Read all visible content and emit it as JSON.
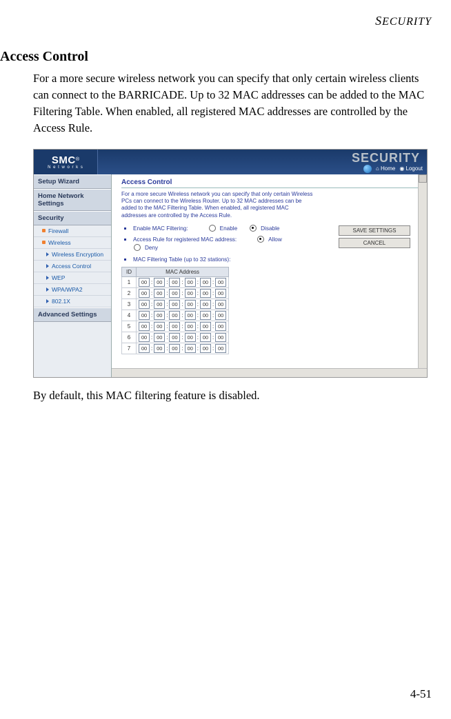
{
  "header": {
    "text_prefix": "S",
    "text_rest": "ECURITY"
  },
  "section": {
    "title": "Access Control",
    "intro": "For a more secure wireless network you can specify that only certain wireless clients can connect to the BARRICADE. Up to 32 MAC addresses can be added to the MAC Filtering Table. When enabled, all registered MAC addresses are controlled by the Access Rule.",
    "outro": "By default, this MAC filtering feature is disabled."
  },
  "page_number": "4-51",
  "screenshot": {
    "logo": {
      "main": "SMC",
      "reg": "®",
      "sub": "N e t w o r k s"
    },
    "banner_title": "SECURITY",
    "nav_right": {
      "home": "Home",
      "logout": "Logout"
    },
    "sidebar": {
      "headers": [
        "Setup Wizard",
        "Home Network Settings",
        "Security",
        "Advanced Settings"
      ],
      "sec_items_top": [
        "Firewall",
        "Wireless"
      ],
      "sec_items_sub": [
        "Wireless Encryption",
        "Access Control",
        "WEP",
        "WPA/WPA2",
        "802.1X"
      ]
    },
    "main": {
      "heading": "Access Control",
      "desc": "For a more secure Wireless network you can specify that only certain Wireless PCs can connect to the Wireless Router. Up to 32 MAC addresses can be added to the MAC Filtering Table. When enabled, all registered MAC addresses are controlled by the Access Rule.",
      "opt_enable_label": "Enable MAC Filtering:",
      "opt_enable": "Enable",
      "opt_disable": "Disable",
      "opt_rule_label": "Access Rule for registered MAC address:",
      "opt_allow": "Allow",
      "opt_deny": "Deny",
      "table_label": "MAC Filtering Table (up to 32 stations):",
      "save": "SAVE SETTINGS",
      "cancel": "CANCEL",
      "table_header_id": "ID",
      "table_header_mac": "MAC Address",
      "rows": [
        "1",
        "2",
        "3",
        "4",
        "5",
        "6",
        "7"
      ],
      "octet": "00"
    }
  }
}
